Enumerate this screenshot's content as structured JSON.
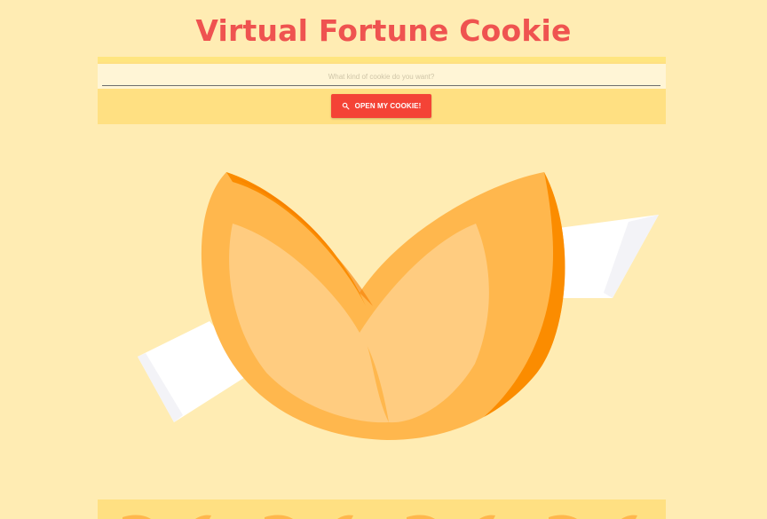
{
  "header": {
    "title": "Virtual Fortune Cookie"
  },
  "search": {
    "placeholder": "What kind of cookie do you want?",
    "value": ""
  },
  "open_button": {
    "label": "OPEN MY COOKIE!",
    "icon": "search-icon"
  },
  "colors": {
    "background": "#FFECB3",
    "panel": "#FFE082",
    "title": "#EF5350",
    "button": "#F44336",
    "cookie_main": "#FFB74D",
    "cookie_light": "#FFCC80",
    "cookie_dark": "#FB8C00",
    "paper": "#FFFFFF"
  }
}
